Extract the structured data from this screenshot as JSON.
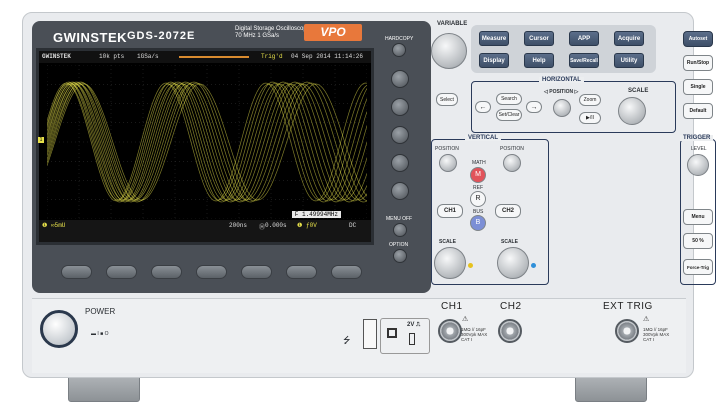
{
  "brand": "GWINSTEK",
  "model": "GDS-2072E",
  "subtitle_line1": "Digital Storage Oscilloscope",
  "subtitle_line2": "70 MHz   1 GSa/s",
  "badge": "VPO",
  "display": {
    "top_logo": "GWINSTEK",
    "record": "10k pts",
    "samplerate": "1GSa/s",
    "trig_status": "Trig'd",
    "datetime": "04 Sep 2014 11:14:26",
    "freq_readout": "1.49994MHz",
    "ch1_scale": "5mU",
    "timebase": "200ns",
    "offset": "0.000s",
    "trig_level": "0V",
    "coupling": "DC"
  },
  "right_panel": {
    "variable_label": "VARIABLE",
    "select_label": "Select",
    "menu_buttons": [
      "Measure",
      "Cursor",
      "APP",
      "Acquire",
      "Display",
      "Help",
      "Save/Recall",
      "Utility"
    ],
    "horizontal_title": "HORIZONTAL",
    "search_label": "Search",
    "setclear_label": "Set/Clear",
    "position_label": "POSITION",
    "zoom_label": "Zoom",
    "playpause_label": "▶/II",
    "scale_label": "SCALE",
    "vertical_title": "VERTICAL",
    "v_position_label1": "POSITION",
    "v_position_label2": "POSITION",
    "math_label": "MATH",
    "math_btn": "M",
    "ref_label": "REF",
    "ref_btn": "R",
    "bus_label": "BUS",
    "bus_btn": "B",
    "ch1_btn": "CH1",
    "ch2_btn": "CH2",
    "v_scale1": "SCALE",
    "v_scale2": "SCALE"
  },
  "trigger": {
    "autoset": "Autoset",
    "runstop": "Run/Stop",
    "single": "Single",
    "default": "Default",
    "title": "TRIGGER",
    "level": "LEVEL",
    "menu": "Menu",
    "fifty": "50 %",
    "force": "Force-Trig"
  },
  "side_labels": {
    "hardcopy": "HARDCOPY",
    "menu_off": "MENU OFF",
    "option": "OPTION"
  },
  "front": {
    "power": "POWER",
    "power_states": "▬ I   ■ O",
    "usb_symbol": "⭍",
    "probe_comp": "2V ⎍",
    "ch1": "CH1",
    "ch2": "CH2",
    "ext_trig": "EXT TRIG",
    "input_spec1": "1MΩ // 16pF\n300Vpk MAX\nCAT I",
    "input_spec2": "1MΩ // 16pF\n300Vpk MAX\nCAT I"
  },
  "colors": {
    "trace": "#e6e04a",
    "accent_blue": "#2a384c",
    "badge_orange": "#e8783b"
  }
}
